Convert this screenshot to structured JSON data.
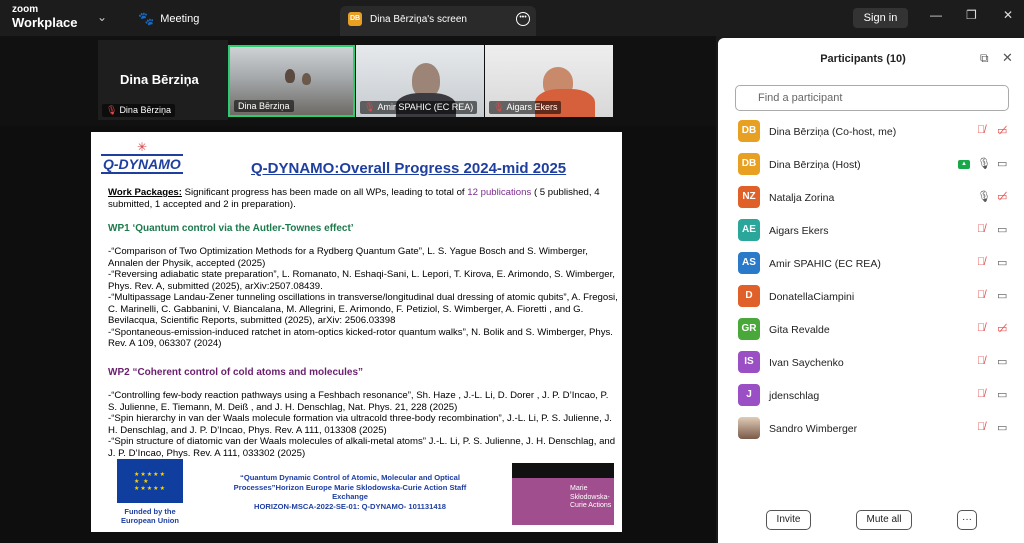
{
  "app": {
    "logo_line1": "zoom",
    "logo_line2": "Workplace",
    "meeting_label": "Meeting",
    "screen_tab_initials": "DB",
    "screen_tab_title": "Dina Bērziņa's screen",
    "signin_label": "Sign in"
  },
  "strip": {
    "name_big": "Dina Bērziņa",
    "name_label": "Dina Bērziņa",
    "tiles": [
      {
        "label": "Dina Bērziņa"
      },
      {
        "label": "Amir SPAHIC (EC REA)"
      },
      {
        "label": "Aigars Ekers"
      }
    ]
  },
  "slide": {
    "logo": "Q-DYNAMO",
    "title": "Q-DYNAMO:Overall Progress 2024-mid 2025",
    "wp_label": "Work Packages:",
    "wp_text_a": " Significant progress has been made on all WPs, leading to total of ",
    "wp_pubs": "12 publications",
    "wp_text_b": " ( 5 published, 4 submitted, 1 accepted and 2 in preparation).",
    "wp1_heading": "WP1 ‘Quantum control via the Autler-Townes effect’",
    "wp1_refs": [
      "-“Comparison of Two Optimization Methods for a Rydberg Quantum Gate”, L. S. Yague Bosch and S. Wimberger, Annalen der Physik, accepted (2025)",
      "-“Reversing adiabatic state preparation”, L. Romanato, N. Eshaqi-Sani, L. Lepori, T. Kirova, E. Arimondo, S. Wimberger, Phys. Rev. A, submitted (2025), arXiv:2507.08439.",
      "-“Multipassage Landau-Zener tunneling oscillations in transverse/longitudinal dual dressing of atomic qubits”, A. Fregosi, C. Marinelli, C. Gabbanini, V. Biancalana, M. Allegrini, E. Arimondo, F. Petiziol, S. Wimberger, A. Fioretti , and G. Bevilacqua, Scientific Reports, submitted (2025), arXiv: 2506.03398",
      "-“Spontaneous-emission-induced ratchet in atom-optics kicked-rotor quantum walks”, N. Bolik and S. Wimberger, Phys. Rev. A 109, 063307 (2024)"
    ],
    "wp2_heading": "WP2 “Coherent control of cold atoms and molecules”",
    "wp2_refs": [
      "-“Controlling few-body reaction pathways using a Feshbach resonance”, Sh. Haze , J.-L. Li, D. Dorer , J. P. D’Incao, P. S. Julienne, E. Tiemann, M. Deiß , and J. H. Denschlag, Nat. Phys. 21, 228 (2025)",
      "-“Spin hierarchy in van der Waals molecule formation via ultracold three-body recombination”, J.-L. Li, P. S. Julienne, J. H. Denschlag, and J. P. D’Incao, Phys. Rev. A 111, 013308 (2025)",
      "-“Spin structure of diatomic van der Waals molecules of alkali-metal atoms” J.-L. Li, P. S. Julienne, J. H. Denschlag, and J. P. D’Incao, Phys. Rev. A 111, 033302 (2025)"
    ],
    "eu_caption": "Funded by the European Union",
    "footer_line1": "“Quantum Dynamic Control of Atomic, Molecular and Optical Processes”Horizon Europe Marie Sklodowska-Curie Action Staff Exchange",
    "footer_line2": "HORIZON-MSCA-2022-SE-01: Q-DYNAMO- 101131418",
    "msca_caption": "Marie Skłodowska-Curie Actions"
  },
  "panel": {
    "title": "Participants (10)",
    "search_placeholder": "Find a participant",
    "invite_label": "Invite",
    "mute_all_label": "Mute all",
    "participants": [
      {
        "initials": "DB",
        "name": "Dina Bērziņa (Co-host, me)",
        "color": "#e8a023",
        "mic": "muted",
        "cam": "off"
      },
      {
        "initials": "DB",
        "name": "Dina Bērziņa (Host)",
        "color": "#e8a023",
        "mic": "on",
        "cam": "on",
        "sharing": true
      },
      {
        "initials": "NZ",
        "name": "Natalja Zorina",
        "color": "#e0602a",
        "mic": "on",
        "cam": "off"
      },
      {
        "initials": "AE",
        "name": "Aigars Ekers",
        "color": "#2aa69a",
        "mic": "muted",
        "cam": "on"
      },
      {
        "initials": "AS",
        "name": "Amir SPAHIC (EC REA)",
        "color": "#2b7ac9",
        "mic": "muted",
        "cam": "on"
      },
      {
        "initials": "D",
        "name": "DonatellaCiampini",
        "color": "#e0602a",
        "mic": "muted",
        "cam": "on"
      },
      {
        "initials": "GR",
        "name": "Gita Revalde",
        "color": "#4aa83a",
        "mic": "muted",
        "cam": "off"
      },
      {
        "initials": "IS",
        "name": "Ivan Saychenko",
        "color": "#9b4fc4",
        "mic": "muted",
        "cam": "on"
      },
      {
        "initials": "J",
        "name": "jdenschlag",
        "color": "#9b4fc4",
        "mic": "muted",
        "cam": "on"
      },
      {
        "initials": "",
        "name": "Sandro Wimberger",
        "color": "#c9a88a",
        "mic": "muted",
        "cam": "on"
      }
    ]
  }
}
